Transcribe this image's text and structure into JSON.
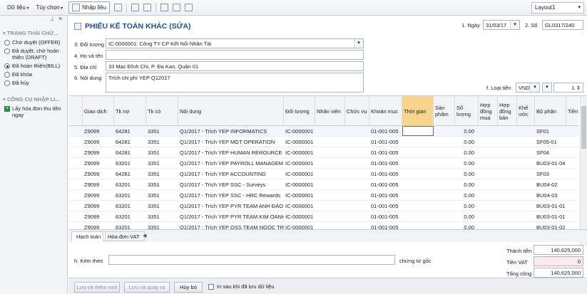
{
  "toolbar": {
    "menu1": "Dữ liệu",
    "menu2": "Tùy chọn",
    "nhap_lieu": "Nhập liệu",
    "layout": "Layout1"
  },
  "left": {
    "section1": "TRANG THÁI CHỨ...",
    "statuses": [
      {
        "label": "Chờ duyệt (OFFER)",
        "checked": false
      },
      {
        "label": "Đã duyệt, chờ hoàn thiện (DRAFT)",
        "checked": false
      },
      {
        "label": "Đã hoàn thiện(BILL)",
        "checked": true
      },
      {
        "label": "Đã khóa",
        "checked": false
      },
      {
        "label": "Đã hủy",
        "checked": false
      }
    ],
    "section2": "CÔNG CỤ NHẬP LI...",
    "tool": "Lấy hóa đơn thu tiền ngay"
  },
  "form": {
    "title": "PHIẾU KẾ TOÁN KHÁC (SỬA)",
    "ngay_label": "1. Ngày",
    "ngay": "31/03/17",
    "so_label": "2. Số",
    "so": "GL0317/240",
    "doi_tuong_label": "3. Đối tượng",
    "doi_tuong": "IC-0000001: Công TY CP Kết Nối Nhân Tài",
    "ho_ten_label": "4. Họ và tên",
    "ho_ten": "",
    "dia_chi_label": "5. Địa chỉ",
    "dia_chi": "33 Mạc Đĩnh Chi, P. Đa Kao, Quận 01",
    "noi_dung_label": "6. Nội dung",
    "noi_dung": "Trích chi phí YEP Q12017",
    "loai_tien_label": "f. Loại tiền",
    "loai_tien": "VND",
    "ty_gia": "1"
  },
  "grid": {
    "headers": [
      "Giao dịch",
      "Tk nợ",
      "Tk có",
      "Nội dung",
      "Đối tượng",
      "Nhân viên",
      "Chức vụ",
      "Khoản mục",
      "Thời gian",
      "Sản phẩm",
      "Số lượng",
      "Hợp đồng mua",
      "Hợp đồng bán",
      "Khế ước",
      "Bộ phận",
      "Tiền"
    ],
    "rows": [
      [
        "Z9099",
        "64281",
        "3351",
        "Q1/2017 - Trích YEP INFORMATICS",
        "IC-0000001",
        "01-001-005",
        "0.00",
        "SF01"
      ],
      [
        "Z9099",
        "64281",
        "3351",
        "Q1/2017 - Trích YEP MGT OPERATION",
        "IC-0000001",
        "01-001-005",
        "0.00",
        "SF05-01"
      ],
      [
        "Z9099",
        "64281",
        "3351",
        "Q1/2017 - Trích YEP HUMAN REROURCE",
        "IC-0000001",
        "01-001-005",
        "0.00",
        "SF04"
      ],
      [
        "Z9099",
        "63201",
        "3351",
        "Q1/2017 - Trích YEP PAYROLL MANAGEM",
        "IC-0000001",
        "01-001-005",
        "0.00",
        "BU03-01-04"
      ],
      [
        "Z9099",
        "64281",
        "3351",
        "Q1/2017 - Trích YEP ACCOUNTING",
        "IC-0000001",
        "01-001-005",
        "0.00",
        "SF03"
      ],
      [
        "Z9099",
        "63201",
        "3351",
        "Q1/2017 - Trích YEP SSC - Surveys",
        "IC-0000001",
        "01-001-005",
        "0.00",
        "BU04-02"
      ],
      [
        "Z9099",
        "63201",
        "3351",
        "Q1/2017 - Trích YEP SSC - HRC Rewards",
        "IC-0000001",
        "01-001-005",
        "0.00",
        "BU04-03"
      ],
      [
        "Z9099",
        "63201",
        "3351",
        "Q1/2017 - Trích YEP PYR TEAM ANH ĐÀO",
        "IC-0000001",
        "01-001-005",
        "0.00",
        "BU03-01-01"
      ],
      [
        "Z9099",
        "63201",
        "3351",
        "Q1/2017 - Trích YEP PYR TEAM KIM OANH",
        "IC-0000001",
        "01-001-005",
        "0.00",
        "BU03-01-01"
      ],
      [
        "Z9099",
        "63201",
        "3351",
        "Q1/2017 - Trích YEP OSS TEAM NGỌC TRÂ",
        "IC-0000001",
        "01-001-005",
        "0.00",
        "BU03-01-02"
      ]
    ],
    "tab1": "Hạch toán",
    "tab2": "Hóa đơn VAT"
  },
  "bottom": {
    "kem_theo_label": "h. Kèm theo",
    "kem_theo": "",
    "chung_tu": "chứng từ gốc",
    "thanh_tien_label": "Thành tiền",
    "thanh_tien": "140,625,000",
    "tien_vat_label": "Tiền VAT",
    "tien_vat": "0",
    "tong_cong_label": "Tổng cộng",
    "tong_cong": "140,625,000"
  },
  "footer": {
    "save_new": "Lưu và thêm mới",
    "save_back": "Lưu và quay ra",
    "cancel": "Hủy bỏ",
    "print_after": "In sau khi đã lưu dữ liệu"
  }
}
